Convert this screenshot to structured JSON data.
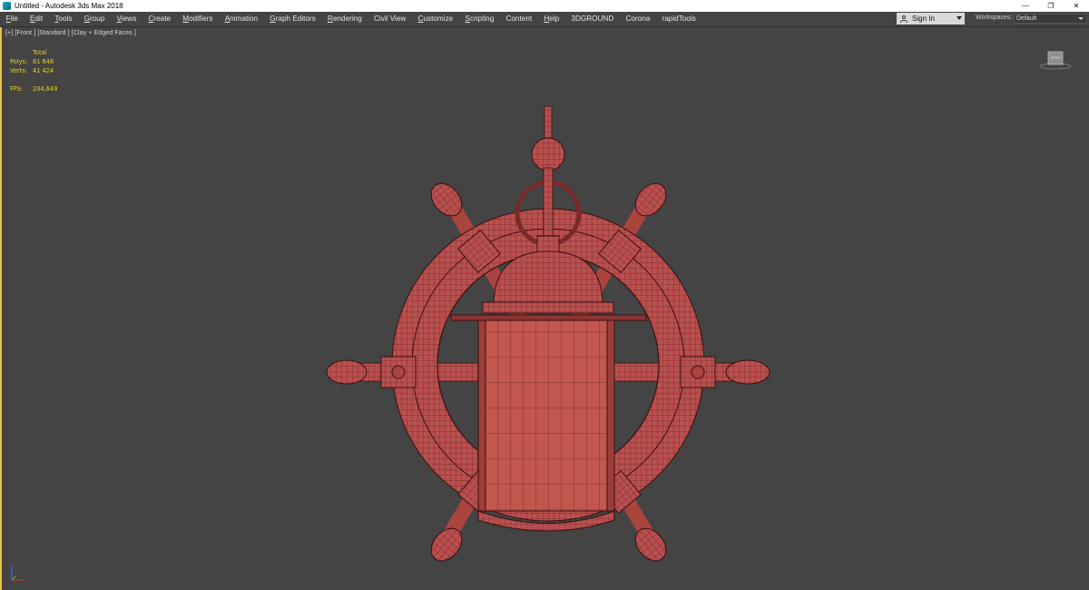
{
  "window": {
    "title": "Untitled - Autodesk 3ds Max 2018",
    "controls": [
      "minimize-icon",
      "restore-icon",
      "close-icon"
    ]
  },
  "menu": {
    "items": [
      {
        "label": "File",
        "u": "F",
        "rest": "ile"
      },
      {
        "label": "Edit",
        "u": "E",
        "rest": "dit"
      },
      {
        "label": "Tools",
        "u": "T",
        "rest": "ools"
      },
      {
        "label": "Group",
        "u": "G",
        "rest": "roup"
      },
      {
        "label": "Views",
        "u": "V",
        "rest": "iews"
      },
      {
        "label": "Create",
        "u": "C",
        "rest": "reate"
      },
      {
        "label": "Modifiers",
        "u": "M",
        "rest": "odifiers"
      },
      {
        "label": "Animation",
        "u": "A",
        "rest": "nimation"
      },
      {
        "label": "Graph Editors",
        "u": "G",
        "rest": "raph Editors"
      },
      {
        "label": "Rendering",
        "u": "R",
        "rest": "endering"
      },
      {
        "label": "Civil View",
        "u": "",
        "rest": "Civil View"
      },
      {
        "label": "Customize",
        "u": "C",
        "rest": "ustomize"
      },
      {
        "label": "Scripting",
        "u": "S",
        "rest": "cripting"
      },
      {
        "label": "Content",
        "u": "",
        "rest": "Content"
      },
      {
        "label": "Help",
        "u": "H",
        "rest": "elp"
      },
      {
        "label": "3DGROUND",
        "u": "",
        "rest": "3DGROUND"
      },
      {
        "label": "Corona",
        "u": "",
        "rest": "Corona"
      },
      {
        "label": "rapidTools",
        "u": "",
        "rest": "rapidTools"
      }
    ],
    "sign_in": "Sign In",
    "workspaces_label": "Workspaces:",
    "workspace_value": "Default"
  },
  "viewport": {
    "label": "[+] [Front ] [Standard ] [Clay + Edged Faces ]",
    "stats": {
      "header": "Total",
      "polys_label": "Polys:",
      "polys": "81 648",
      "verts_label": "Verts:",
      "verts": "41 424",
      "fps_label": "FPS:",
      "fps": "204,649"
    }
  },
  "colors": {
    "viewport_bg": "#444444",
    "clay": "#b9504f",
    "wire": "#3a0f0f",
    "stats_text": "#e3d42c",
    "active_border": "#e8c24a"
  }
}
